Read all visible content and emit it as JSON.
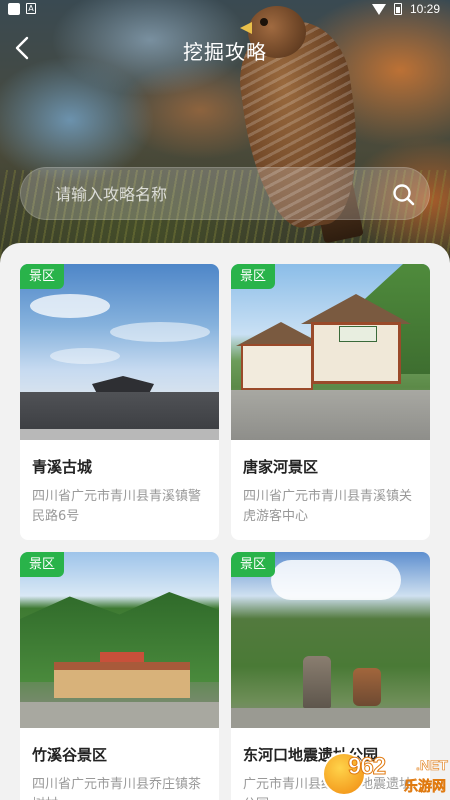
{
  "status_bar": {
    "time": "10:29",
    "left_icon_letter": "A"
  },
  "header": {
    "title": "挖掘攻略",
    "back_icon": "chevron-left-icon"
  },
  "search": {
    "placeholder": "请输入攻略名称",
    "value": "",
    "icon": "search-icon"
  },
  "cards": [
    {
      "badge": "景区",
      "title": "青溪古城",
      "address": "四川省广元市青川县青溪镇警民路6号"
    },
    {
      "badge": "景区",
      "title": "唐家河景区",
      "address": "四川省广元市青川县青溪镇关虎游客中心"
    },
    {
      "badge": "景区",
      "title": "竹溪谷景区",
      "address": "四川省广元市青川县乔庄镇茶树村"
    },
    {
      "badge": "景区",
      "title": "东河口地震遗址公园",
      "address": "广元市青川县红光乡地震遗址公园"
    }
  ],
  "watermark": {
    "number": "962",
    "suffix": ".NET",
    "label": "乐游网"
  },
  "colors": {
    "badge_green": "#29b34a",
    "title_text": "#222222",
    "address_text": "#999999",
    "panel_bg": "#f2f2f2"
  }
}
